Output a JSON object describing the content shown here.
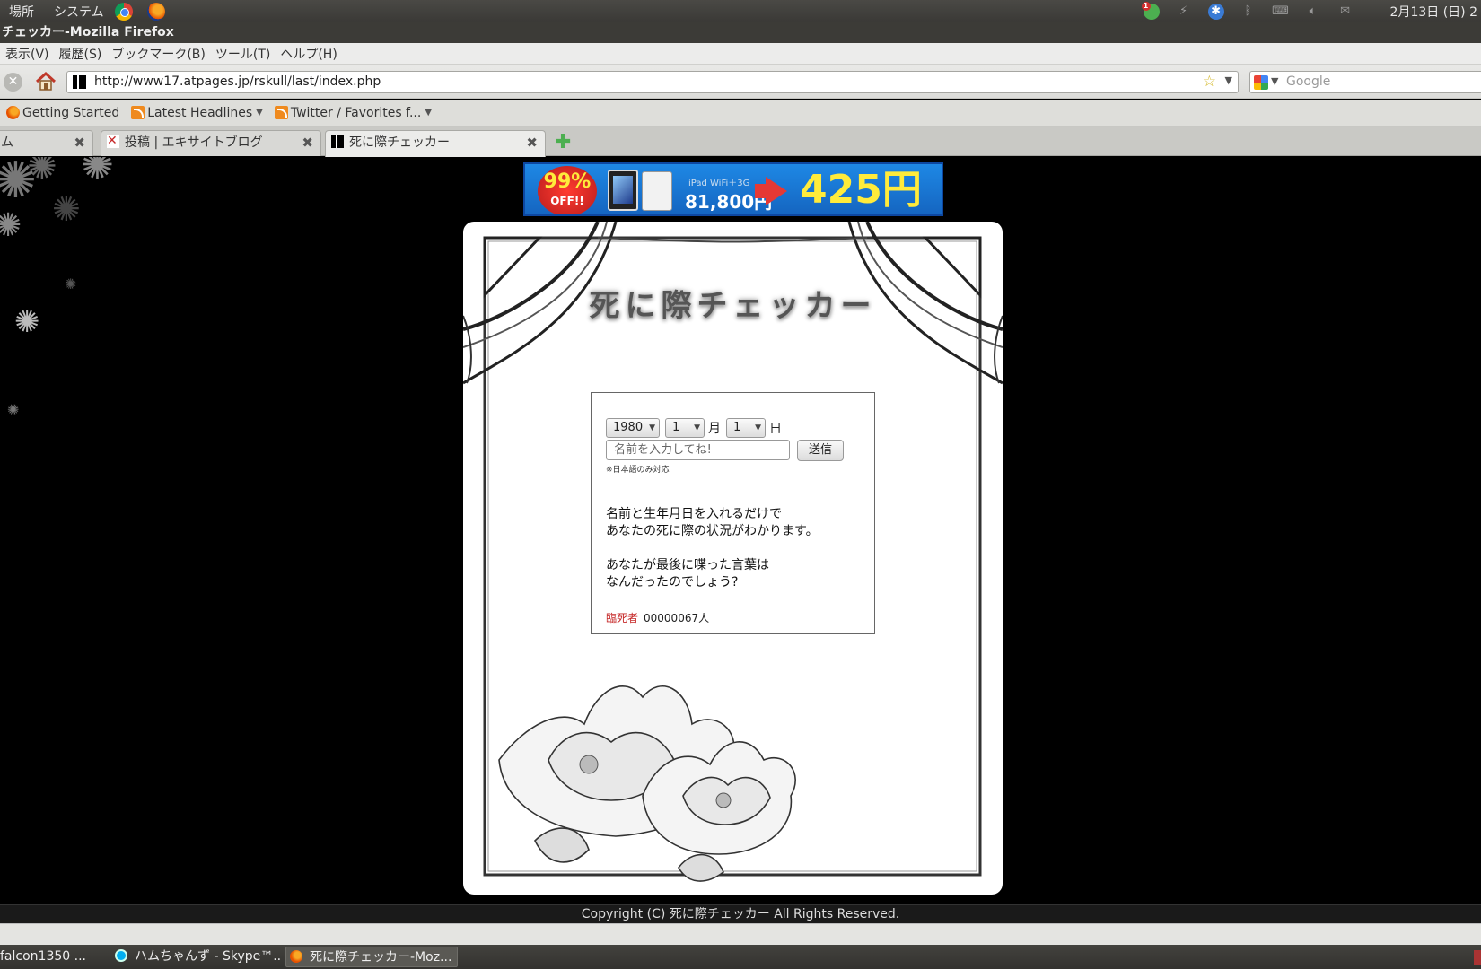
{
  "system_panel": {
    "menus": [
      "場所",
      "システム"
    ],
    "clock": "2月13日 (日) 2"
  },
  "window": {
    "title": "チェッカー-Mozilla Firefox"
  },
  "menubar": {
    "items": [
      "表示(V)",
      "履歴(S)",
      "ブックマーク(B)",
      "ツール(T)",
      "ヘルプ(H)"
    ]
  },
  "navbar": {
    "url": "http://www17.atpages.jp/rskull/last/index.php",
    "search_placeholder": "Google"
  },
  "bookmarks": {
    "items": [
      {
        "label": "Getting Started",
        "icon": "firefox-icon"
      },
      {
        "label": "Latest Headlines",
        "icon": "rss-icon"
      },
      {
        "label": "Twitter / Favorites f...",
        "icon": "rss-icon"
      }
    ]
  },
  "tabs": [
    {
      "label": "ム",
      "active": false
    },
    {
      "label": "投稿 | エキサイトブログ",
      "active": false
    },
    {
      "label": "死に際チェッカー",
      "active": true
    }
  ],
  "banner": {
    "badge_pct": "99%",
    "badge_off": "OFF!!",
    "small_text": "iPad WiFi＋3G",
    "old_price": "81,800円",
    "new_price": "425円"
  },
  "page": {
    "title": "死に際チェッカー",
    "form": {
      "year": "1980",
      "month": "1",
      "day": "1",
      "month_unit": "月",
      "day_unit": "日",
      "name_placeholder": "名前を入力してね!",
      "submit_label": "送信",
      "note": "※日本語のみ対応"
    },
    "description": {
      "p1_line1": "名前と生年月日を入れるだけで",
      "p1_line2": "あなたの死に際の状況がわかります。",
      "p2_line1": "あなたが最後に喋った言葉は",
      "p2_line2": "なんだったのでしょう?"
    },
    "counter": {
      "label": "臨死者",
      "value": "00000067人"
    },
    "copyright": "Copyright (C) 死に際チェッカー All Rights Reserved."
  },
  "taskbar": {
    "tasks": [
      {
        "label": "falcon1350 ...",
        "icon": ""
      },
      {
        "label": "ハムちゃんず - Skype™...",
        "icon": "skype-icon"
      },
      {
        "label": "死に際チェッカー-Moz...",
        "icon": "firefox-icon"
      }
    ]
  },
  "colors": {
    "counter_label": "#c62828",
    "banner_blue": "#1565c0",
    "banner_yellow": "#ffeb3b"
  }
}
